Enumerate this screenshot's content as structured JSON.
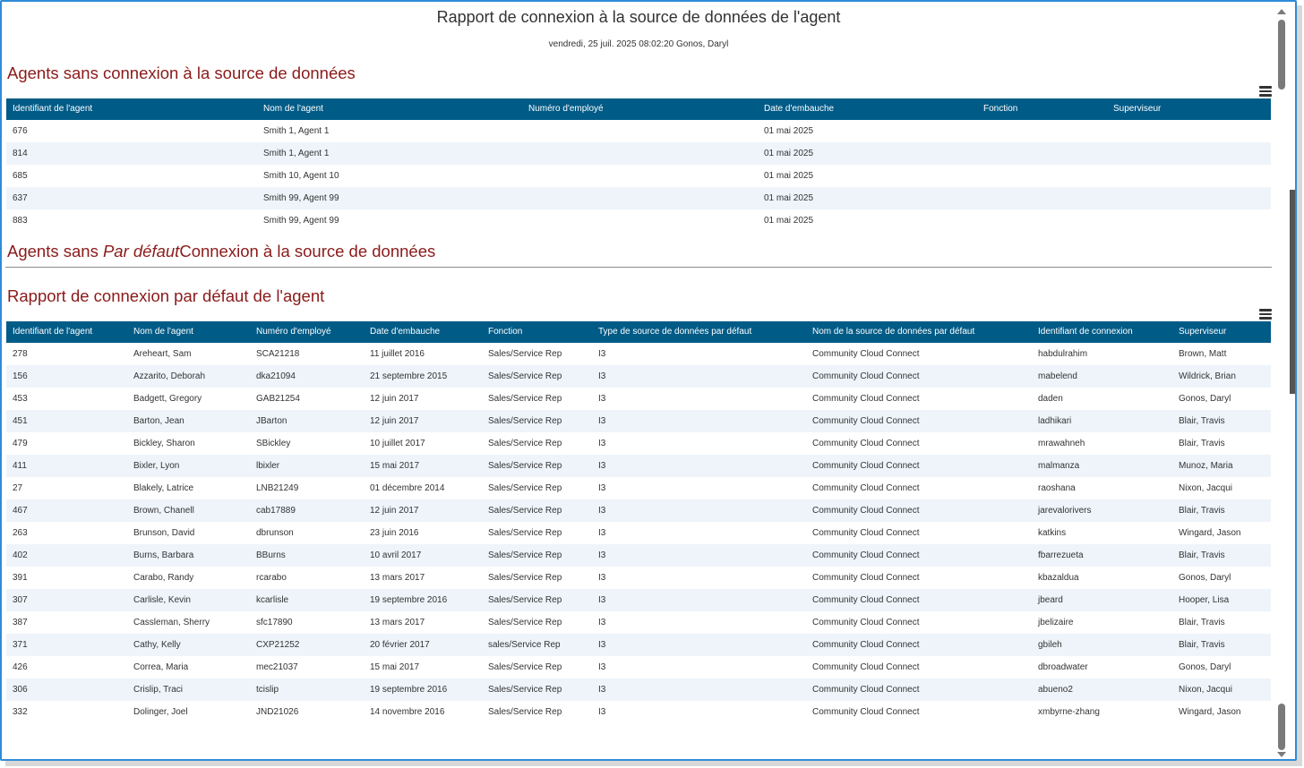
{
  "report": {
    "title": "Rapport de connexion à la source de données de l'agent",
    "subtitle": "vendredi, 25 juil. 2025 08:02:20  Gonos, Daryl"
  },
  "section1": {
    "title": "Agents sans connexion à la source de données",
    "headers": [
      "Identifiant de l'agent",
      "Nom de l'agent",
      "Numéro d'employé",
      "Date d'embauche",
      "Fonction",
      "Superviseur"
    ],
    "rows": [
      [
        "676",
        "Smith 1, Agent 1",
        "",
        "01 mai 2025",
        "",
        ""
      ],
      [
        "814",
        "Smith 1, Agent 1",
        "",
        "01 mai 2025",
        "",
        ""
      ],
      [
        "685",
        "Smith 10, Agent 10",
        "",
        "01 mai 2025",
        "",
        ""
      ],
      [
        "637",
        "Smith 99, Agent 99",
        "",
        "01 mai 2025",
        "",
        ""
      ],
      [
        "883",
        "Smith 99, Agent 99",
        "",
        "01 mai 2025",
        "",
        ""
      ]
    ]
  },
  "section2": {
    "title_pre": "Agents sans ",
    "title_em": "Par défaut",
    "title_post": "Connexion à la source de données"
  },
  "section3": {
    "title": "Rapport de connexion par défaut de l'agent",
    "headers": [
      "Identifiant de l'agent",
      "Nom de l'agent",
      "Numéro d'employé",
      "Date d'embauche",
      "Fonction",
      "Type de source de données par défaut",
      "Nom de la source de données par défaut",
      "Identifiant de connexion",
      "Superviseur"
    ],
    "rows": [
      [
        "278",
        "Areheart, Sam",
        "SCA21218",
        "11 juillet 2016",
        "Sales/Service Rep",
        "I3",
        "Community Cloud Connect",
        "habdulrahim",
        "Brown, Matt"
      ],
      [
        "156",
        "Azzarito, Deborah",
        "dka21094",
        "21 septembre 2015",
        "Sales/Service Rep",
        "I3",
        "Community Cloud Connect",
        "mabelend",
        "Wildrick, Brian"
      ],
      [
        "453",
        "Badgett, Gregory",
        "GAB21254",
        "12 juin 2017",
        "Sales/Service Rep",
        "I3",
        "Community Cloud Connect",
        "daden",
        "Gonos, Daryl"
      ],
      [
        "451",
        "Barton, Jean",
        "JBarton",
        "12 juin 2017",
        "Sales/Service Rep",
        "I3",
        "Community Cloud Connect",
        "ladhikari",
        "Blair, Travis"
      ],
      [
        "479",
        "Bickley, Sharon",
        "SBickley",
        "10 juillet 2017",
        "Sales/Service Rep",
        "I3",
        "Community Cloud Connect",
        "mrawahneh",
        "Blair, Travis"
      ],
      [
        "411",
        "Bixler, Lyon",
        "lbixler",
        "15 mai 2017",
        "Sales/Service Rep",
        "I3",
        "Community Cloud Connect",
        "malmanza",
        "Munoz, Maria"
      ],
      [
        "27",
        "Blakely, Latrice",
        "LNB21249",
        "01 décembre 2014",
        "Sales/Service Rep",
        "I3",
        "Community Cloud Connect",
        "raoshana",
        "Nixon, Jacqui"
      ],
      [
        "467",
        "Brown, Chanell",
        "cab17889",
        "12 juin 2017",
        "Sales/Service Rep",
        "I3",
        "Community Cloud Connect",
        "jarevalorivers",
        "Blair, Travis"
      ],
      [
        "263",
        "Brunson, David",
        "dbrunson",
        "23 juin 2016",
        "Sales/Service Rep",
        "I3",
        "Community Cloud Connect",
        "katkins",
        "Wingard, Jason"
      ],
      [
        "402",
        "Burns, Barbara",
        "BBurns",
        "10 avril 2017",
        "Sales/Service Rep",
        "I3",
        "Community Cloud Connect",
        "fbarrezueta",
        "Blair, Travis"
      ],
      [
        "391",
        "Carabo, Randy",
        "rcarabo",
        "13 mars 2017",
        "Sales/Service Rep",
        "I3",
        "Community Cloud Connect",
        "kbazaldua",
        "Gonos, Daryl"
      ],
      [
        "307",
        "Carlisle, Kevin",
        "kcarlisle",
        "19 septembre 2016",
        "Sales/Service Rep",
        "I3",
        "Community Cloud Connect",
        "jbeard",
        "Hooper, Lisa"
      ],
      [
        "387",
        "Cassleman, Sherry",
        "sfc17890",
        "13 mars 2017",
        "Sales/Service Rep",
        "I3",
        "Community Cloud Connect",
        "jbelizaire",
        "Blair, Travis"
      ],
      [
        "371",
        "Cathy, Kelly",
        "CXP21252",
        "20 février 2017",
        "sales/Service Rep",
        "I3",
        "Community Cloud Connect",
        "gbileh",
        "Blair, Travis"
      ],
      [
        "426",
        "Correa, Maria",
        "mec21037",
        "15 mai 2017",
        "Sales/Service Rep",
        "I3",
        "Community Cloud Connect",
        "dbroadwater",
        "Gonos, Daryl"
      ],
      [
        "306",
        "Crislip, Traci",
        "tcislip",
        "19 septembre 2016",
        "Sales/Service Rep",
        "I3",
        "Community Cloud Connect",
        "abueno2",
        "Nixon, Jacqui"
      ],
      [
        "332",
        "Dolinger, Joel",
        "JND21026",
        "14 novembre 2016",
        "Sales/Service Rep",
        "I3",
        "Community Cloud Connect",
        "xmbyrne-zhang",
        "Wingard, Jason"
      ]
    ]
  },
  "icons": {
    "menu": "hamburger-menu-icon",
    "scroll_up": "arrow-up-icon",
    "scroll_down": "arrow-down-icon"
  },
  "colors": {
    "header_bg": "#005b87",
    "section_title": "#8b1a1a",
    "row_alt": "#eef4fa",
    "frame_border": "#2e8bd8"
  }
}
